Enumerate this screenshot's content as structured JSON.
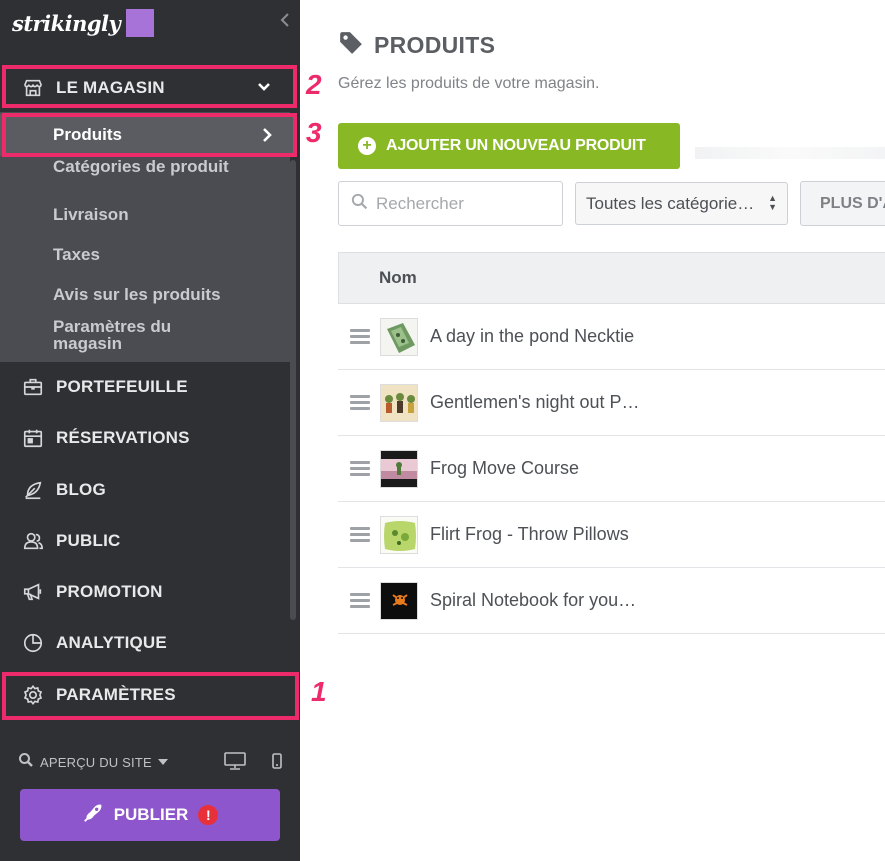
{
  "app": {
    "logo_text": "strikingly",
    "brand_color": "#a873d8"
  },
  "sidebar": {
    "store": {
      "label": "LE MAGASIN"
    },
    "submenu": [
      {
        "label": "Produits"
      },
      {
        "label": "Catégories de produit"
      },
      {
        "label": "Livraison"
      },
      {
        "label": "Taxes"
      },
      {
        "label": "Avis sur les produits"
      },
      {
        "label": "Paramètres du magasin"
      }
    ],
    "items": [
      {
        "label": "PORTEFEUILLE",
        "icon": "briefcase-icon"
      },
      {
        "label": "RÉSERVATIONS",
        "icon": "calendar-icon"
      },
      {
        "label": "BLOG",
        "icon": "feather-icon"
      },
      {
        "label": "PUBLIC",
        "icon": "people-icon"
      },
      {
        "label": "PROMOTION",
        "icon": "megaphone-icon"
      },
      {
        "label": "ANALYTIQUE",
        "icon": "pie-chart-icon"
      },
      {
        "label": "PARAMÈTRES",
        "icon": "gear-icon"
      }
    ],
    "preview_label": "APERÇU DU SITE",
    "publish_label": "PUBLIER",
    "publish_alert": "!"
  },
  "annotations": {
    "one": "1",
    "two": "2",
    "three": "3",
    "color": "#ed2a6a"
  },
  "main": {
    "title": "PRODUITS",
    "subtitle": "Gérez les produits de votre magasin.",
    "add_button": "AJOUTER UN NOUVEAU PRODUIT",
    "search_placeholder": "Rechercher",
    "category_select": "Toutes les catégorie…",
    "more_button": "PLUS D'A",
    "table_header": "Nom",
    "products": [
      {
        "name": "A day in the pond Necktie"
      },
      {
        "name": "Gentlemen's night out P…"
      },
      {
        "name": "Frog Move Course"
      },
      {
        "name": "Flirt Frog - Throw Pillows"
      },
      {
        "name": "Spiral Notebook for you…"
      }
    ]
  }
}
